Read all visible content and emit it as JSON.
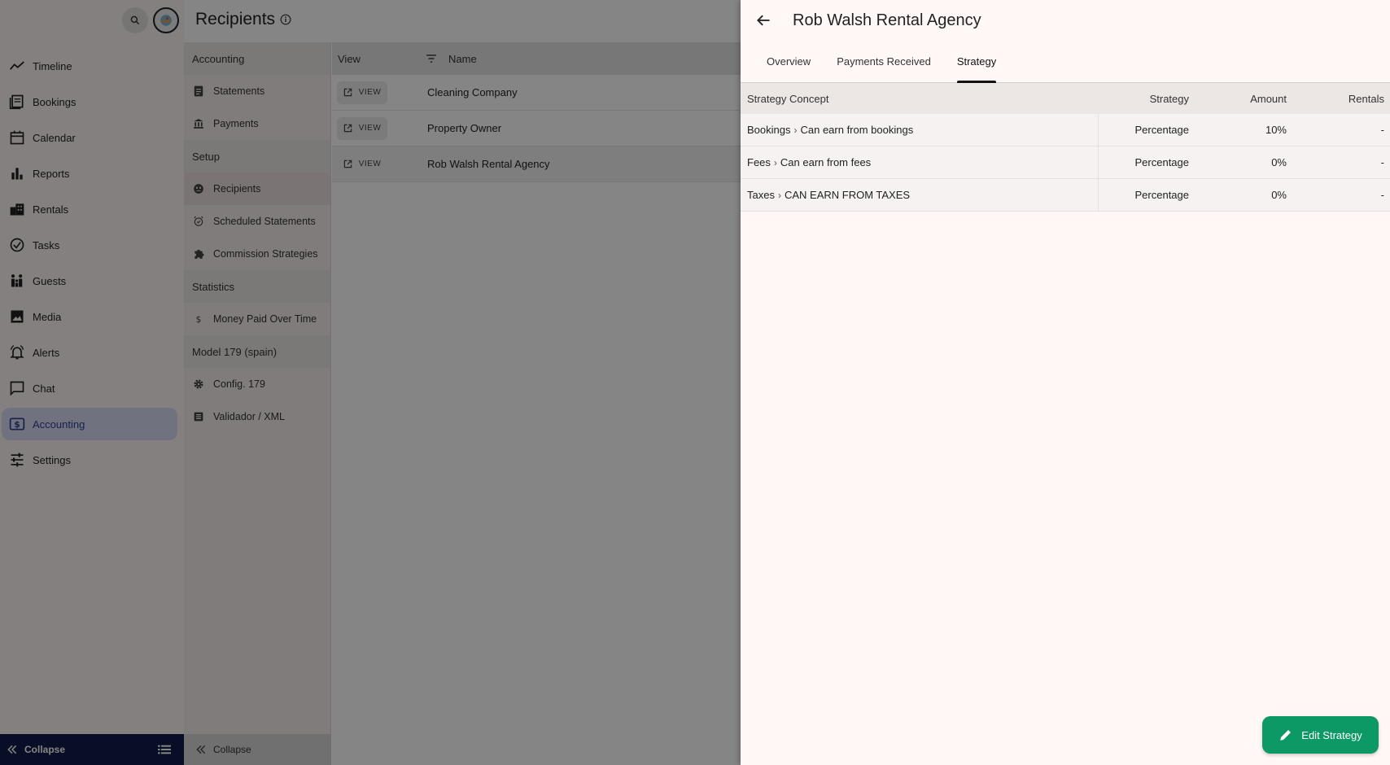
{
  "nav": {
    "items": [
      {
        "label": "Timeline",
        "icon": "timeline-icon"
      },
      {
        "label": "Bookings",
        "icon": "bookings-icon"
      },
      {
        "label": "Calendar",
        "icon": "calendar-icon"
      },
      {
        "label": "Reports",
        "icon": "reports-icon"
      },
      {
        "label": "Rentals",
        "icon": "rentals-icon"
      },
      {
        "label": "Tasks",
        "icon": "tasks-icon"
      },
      {
        "label": "Guests",
        "icon": "guests-icon"
      },
      {
        "label": "Media",
        "icon": "media-icon"
      },
      {
        "label": "Alerts",
        "icon": "alerts-icon"
      },
      {
        "label": "Chat",
        "icon": "chat-icon"
      },
      {
        "label": "Accounting",
        "icon": "accounting-icon",
        "active": true
      },
      {
        "label": "Settings",
        "icon": "settings-icon"
      }
    ],
    "collapse_label": "Collapse"
  },
  "subnav": {
    "sections": [
      {
        "title": "Accounting",
        "items": [
          {
            "label": "Statements",
            "icon": "statements-icon"
          },
          {
            "label": "Payments",
            "icon": "payments-icon"
          }
        ]
      },
      {
        "title": "Setup",
        "items": [
          {
            "label": "Recipients",
            "icon": "recipients-icon",
            "active": true
          },
          {
            "label": "Scheduled Statements",
            "icon": "alarm-icon"
          },
          {
            "label": "Commission Strategies",
            "icon": "puzzle-icon"
          }
        ]
      },
      {
        "title": "Statistics",
        "items": [
          {
            "label": "Money Paid Over Time",
            "icon": "dollar-icon"
          }
        ]
      },
      {
        "title": "Model 179 (spain)",
        "items": [
          {
            "label": "Config. 179",
            "icon": "gear-icon"
          },
          {
            "label": "Validador / XML",
            "icon": "list-icon"
          }
        ]
      }
    ],
    "collapse_label": "Collapse"
  },
  "page": {
    "title": "Recipients"
  },
  "recipients_table": {
    "columns": {
      "view": "View",
      "name": "Name"
    },
    "view_label": "VIEW",
    "rows": [
      {
        "name": "Cleaning Company"
      },
      {
        "name": "Property Owner"
      },
      {
        "name": "Rob Walsh Rental Agency",
        "selected": true
      }
    ]
  },
  "drawer": {
    "title": "Rob Walsh Rental Agency",
    "tabs": [
      {
        "label": "Overview"
      },
      {
        "label": "Payments Received"
      },
      {
        "label": "Strategy",
        "active": true
      }
    ],
    "table": {
      "columns": {
        "concept": "Strategy Concept",
        "strategy": "Strategy",
        "amount": "Amount",
        "rentals": "Rentals"
      },
      "rows": [
        {
          "category": "Bookings",
          "concept": "Can earn from bookings",
          "strategy": "Percentage",
          "amount": "10%",
          "rentals": "-"
        },
        {
          "category": "Fees",
          "concept": "Can earn from fees",
          "strategy": "Percentage",
          "amount": "0%",
          "rentals": "-"
        },
        {
          "category": "Taxes",
          "concept": "CAN EARN FROM TAXES",
          "strategy": "Percentage",
          "amount": "0%",
          "rentals": "-"
        }
      ]
    },
    "fab_label": "Edit Strategy"
  },
  "colors": {
    "accent": "#0d9966",
    "nav_active_bg": "#d6dcf4",
    "nav_collapse_bg": "#0f1b47"
  }
}
